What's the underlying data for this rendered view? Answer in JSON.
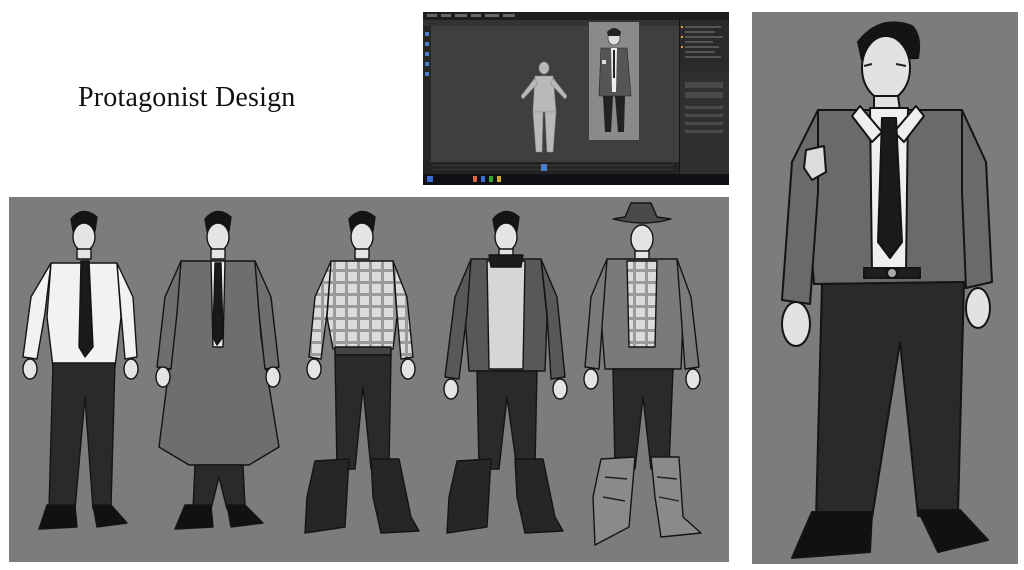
{
  "title": "Protagonist Design",
  "colors": {
    "panel": "#7c7c7c",
    "ink": "#141414",
    "shirt": "#f2f2f2",
    "jeans": "#2a2a2a",
    "jacket": "#6e6e6e"
  },
  "figures": [
    {
      "outfit": "white-shirt-tie"
    },
    {
      "outfit": "trench-coat"
    },
    {
      "outfit": "plaid-shirt"
    },
    {
      "outfit": "leather-jacket-sweater"
    },
    {
      "outfit": "cowboy-hat-boots"
    }
  ],
  "closeup": {
    "outfit": "jacket-shirt-tie"
  },
  "blender": {
    "app": "3d-modeling-software"
  }
}
